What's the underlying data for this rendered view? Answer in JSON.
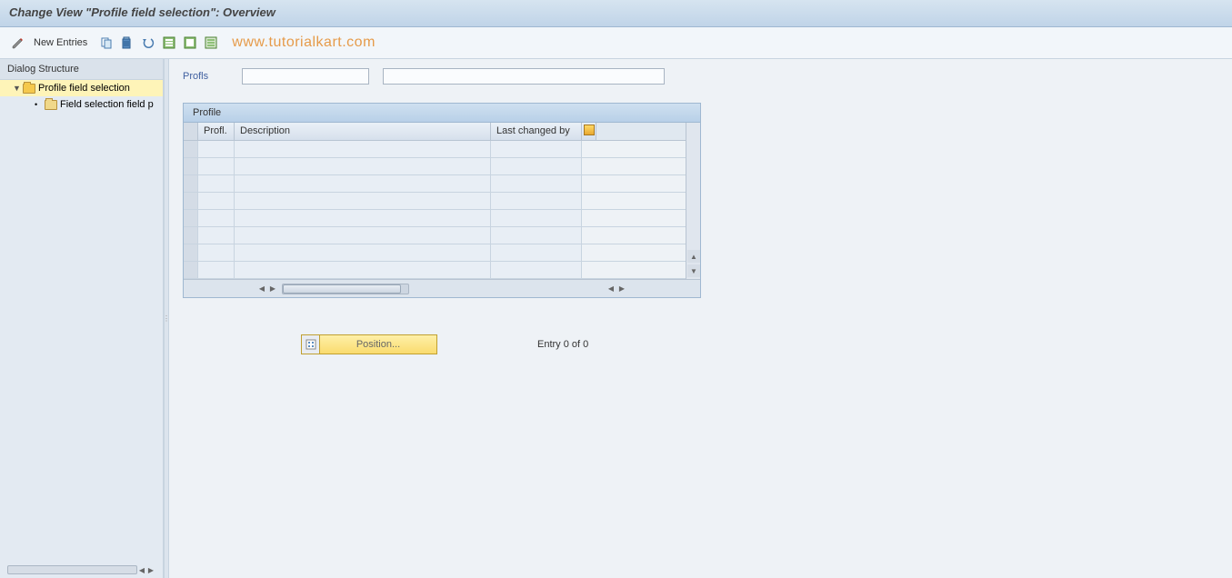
{
  "title_bar": "Change View \"Profile field selection\": Overview",
  "toolbar": {
    "new_entries": "New Entries"
  },
  "watermark": "www.tutorialkart.com",
  "sidebar": {
    "header": "Dialog Structure",
    "items": [
      {
        "label": "Profile field selection",
        "selected": true,
        "level": 0
      },
      {
        "label": "Field selection field p",
        "selected": false,
        "level": 1
      }
    ]
  },
  "content": {
    "field_label": "Profls",
    "table_title": "Profile",
    "columns": {
      "profl": "Profl.",
      "description": "Description",
      "last_changed": "Last changed by"
    },
    "position_button": "Position...",
    "entry_status": "Entry 0 of 0"
  }
}
